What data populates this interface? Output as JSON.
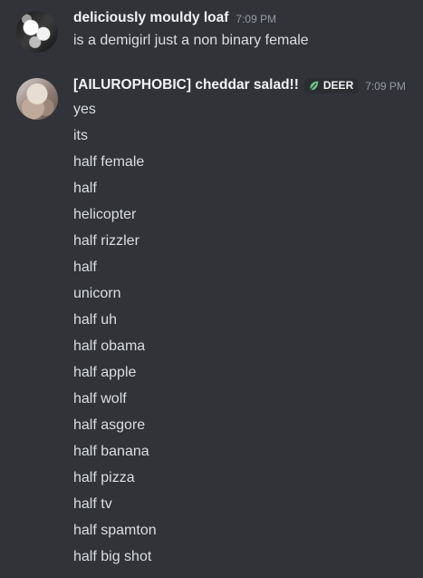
{
  "messages": [
    {
      "username": "deliciously mouldy loaf",
      "timestamp": "7:09 PM",
      "avatar_icon": "pixelated-black-white-avatar",
      "lines": [
        "is a demigirl just a non binary female"
      ]
    },
    {
      "username": "[AILUROPHOBIC] cheddar salad!!",
      "timestamp": "7:09 PM",
      "avatar_icon": "beige-photo-avatar",
      "tag": {
        "label": "DEER",
        "icon": "leaf-icon",
        "icon_color": "#67c587"
      },
      "lines": [
        "yes",
        "its",
        "half female",
        "half",
        "helicopter",
        "half rizzler",
        "half",
        "unicorn",
        "half uh",
        "half obama",
        "half apple",
        "half wolf",
        "half asgore",
        "half banana",
        "half pizza",
        "half tv",
        "half spamton",
        "half big shot"
      ]
    }
  ],
  "colors": {
    "background": "#313338",
    "username": "#f2f3f5",
    "text": "#dbdee1",
    "timestamp": "#949ba4",
    "tag_background": "#2b2d31"
  }
}
